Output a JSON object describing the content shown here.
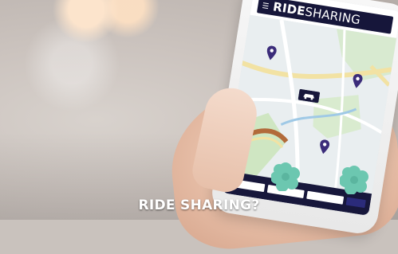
{
  "app": {
    "brand_prefix": "RIDE",
    "brand_suffix": "SHARING"
  },
  "caption": "RIDE SHARING?",
  "icons": [
    "menu-icon",
    "map-pin-icon",
    "car-marker-icon",
    "flower-badge-icon"
  ],
  "colors": {
    "navy": "#16163a",
    "pin": "#3b2c7a",
    "road_yellow": "#f2e2a3",
    "park_green": "#cfe6c2",
    "route_brown": "#b26a3a",
    "flower_teal": "#6cc7b0"
  }
}
